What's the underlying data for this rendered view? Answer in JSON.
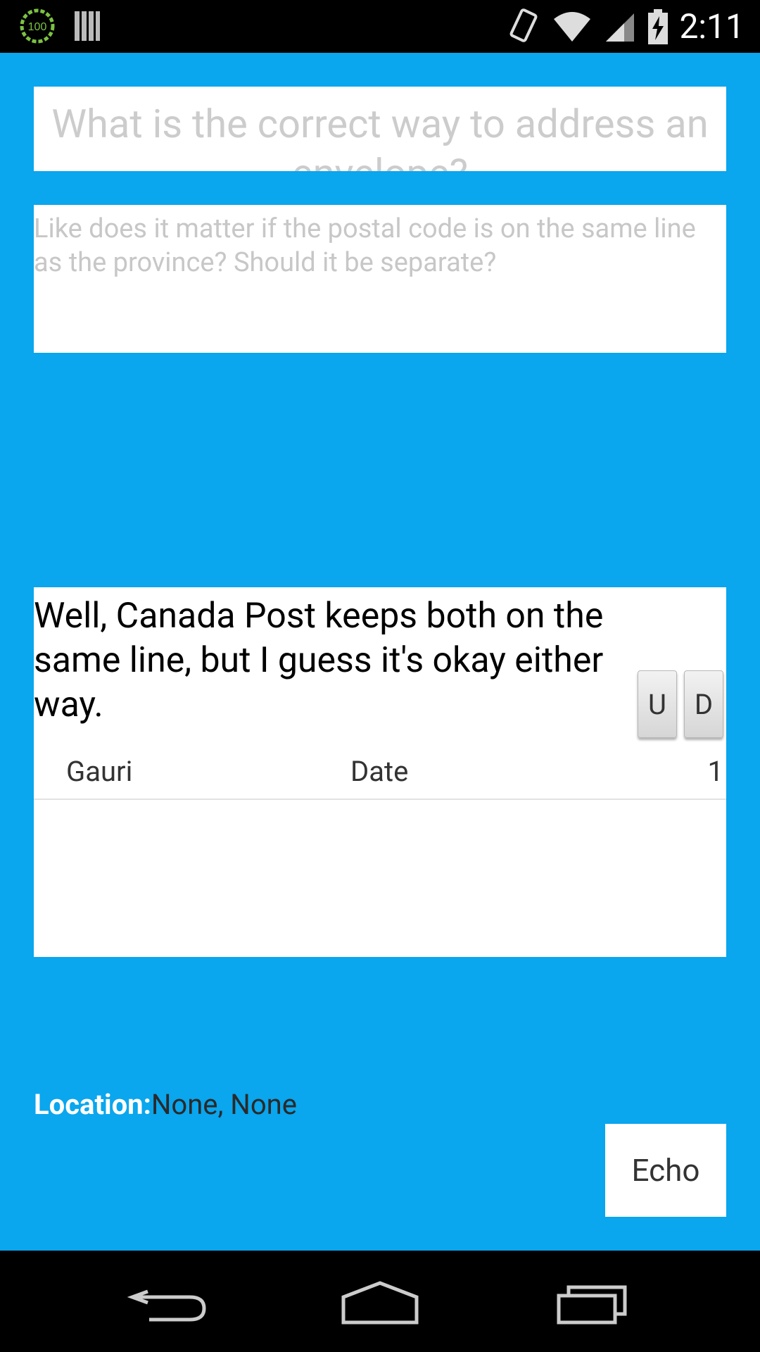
{
  "status_bar": {
    "battery_level": "100",
    "time": "2:11"
  },
  "question": {
    "title": "What is the correct way to address an envelope?",
    "body": "Like does it matter if the postal code is on the same line as the province? Should it be separate?"
  },
  "answer": {
    "text": "Well, Canada Post keeps both on the same line, but I guess it's okay either way.",
    "up_label": "U",
    "down_label": "D",
    "author": "Gauri",
    "date": "Date",
    "score": "1"
  },
  "location": {
    "label": "Location:",
    "value": "None, None"
  },
  "actions": {
    "echo_label": "Echo"
  },
  "colors": {
    "background": "#0aa6ee",
    "card": "#ffffff"
  }
}
